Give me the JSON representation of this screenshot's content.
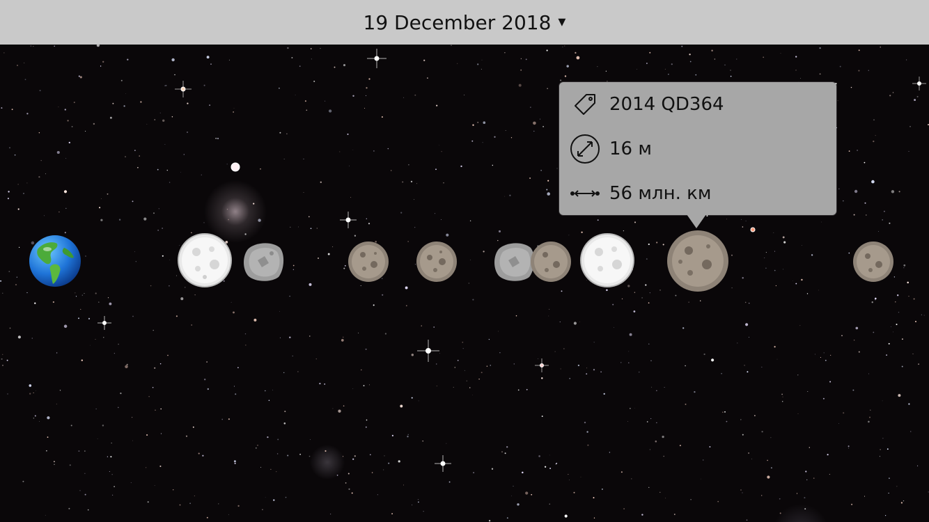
{
  "header": {
    "date_label": "19 December 2018",
    "caret": "▾"
  },
  "scene": {
    "bodies": [
      {
        "name": "earth",
        "icon": "earth-icon"
      },
      {
        "name": "moon",
        "icon": "moon-icon"
      },
      {
        "name": "asteroid-grey",
        "icon": "asteroid-icon"
      },
      {
        "name": "asteroid-brown",
        "icon": "asteroid-icon"
      },
      {
        "name": "asteroid-brown",
        "icon": "asteroid-icon"
      },
      {
        "name": "asteroid-grey",
        "icon": "asteroid-icon"
      },
      {
        "name": "asteroid-brown",
        "icon": "asteroid-icon"
      },
      {
        "name": "moon",
        "icon": "moon-icon"
      },
      {
        "name": "asteroid-selected",
        "icon": "asteroid-icon"
      },
      {
        "name": "asteroid-brown",
        "icon": "asteroid-icon"
      }
    ]
  },
  "tooltip": {
    "name": "2014 QD364",
    "diameter": "16 м",
    "distance": "56 млн. км",
    "icons": [
      "tag-icon",
      "diameter-icon",
      "distance-icon"
    ]
  },
  "colors": {
    "header_bg": "#c9c9c9",
    "tooltip_bg": "#a7a7a7",
    "sky_bg": "#0a0709"
  }
}
